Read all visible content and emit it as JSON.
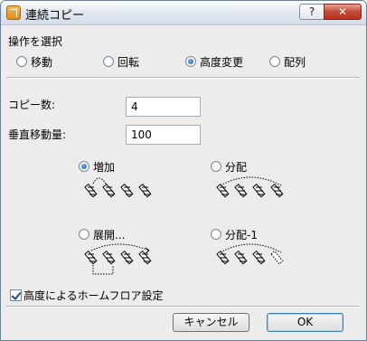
{
  "window": {
    "title": "連続コピー",
    "help_label": "?",
    "close_label": "✕",
    "app_icon": "app-icon"
  },
  "operation": {
    "group_label": "操作を選択",
    "options": [
      {
        "label": "移動",
        "checked": false
      },
      {
        "label": "回転",
        "checked": false
      },
      {
        "label": "高度変更",
        "checked": true
      },
      {
        "label": "配列",
        "checked": false
      }
    ]
  },
  "fields": {
    "copies_label": "コピー数:",
    "copies_value": "4",
    "vertical_label": "垂直移動量:",
    "vertical_value": "100"
  },
  "methods": [
    {
      "label": "増加",
      "checked": true
    },
    {
      "label": "分配",
      "checked": false
    },
    {
      "label": "展開...",
      "checked": false
    },
    {
      "label": "分配-1",
      "checked": false
    }
  ],
  "home_floor_label": "高度によるホームフロア設定",
  "home_floor_checked": true,
  "buttons": {
    "cancel": "キャンセル",
    "ok": "OK"
  }
}
